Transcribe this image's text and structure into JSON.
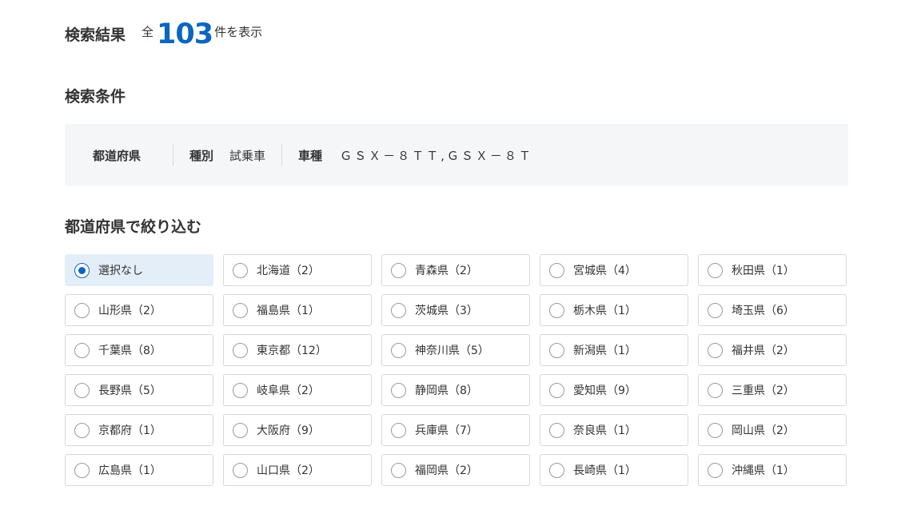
{
  "result": {
    "title": "検索結果",
    "prefix": "全",
    "count": "103",
    "suffix": "件を表示"
  },
  "conditions": {
    "title": "検索条件",
    "prefecture_label": "都道府県",
    "type_label": "種別",
    "type_value": "試乗車",
    "model_label": "車種",
    "model_value": "ＧＳＸ－８ＴＴ,ＧＳＸ－８Ｔ"
  },
  "filter": {
    "title": "都道府県で絞り込む",
    "selected_index": 0,
    "options": [
      "選択なし",
      "北海道（2）",
      "青森県（2）",
      "宮城県（4）",
      "秋田県（1）",
      "山形県（2）",
      "福島県（1）",
      "茨城県（3）",
      "栃木県（1）",
      "埼玉県（6）",
      "千葉県（8）",
      "東京都（12）",
      "神奈川県（5）",
      "新潟県（1）",
      "福井県（2）",
      "長野県（5）",
      "岐阜県（2）",
      "静岡県（8）",
      "愛知県（9）",
      "三重県（2）",
      "京都府（1）",
      "大阪府（9）",
      "兵庫県（7）",
      "奈良県（1）",
      "岡山県（2）",
      "広島県（1）",
      "山口県（2）",
      "福岡県（2）",
      "長崎県（1）",
      "沖縄県（1）"
    ]
  },
  "colors": {
    "accent": "#0b65c2",
    "selected_bg": "#e4eef8",
    "conditions_bg": "#f5f6f8"
  }
}
